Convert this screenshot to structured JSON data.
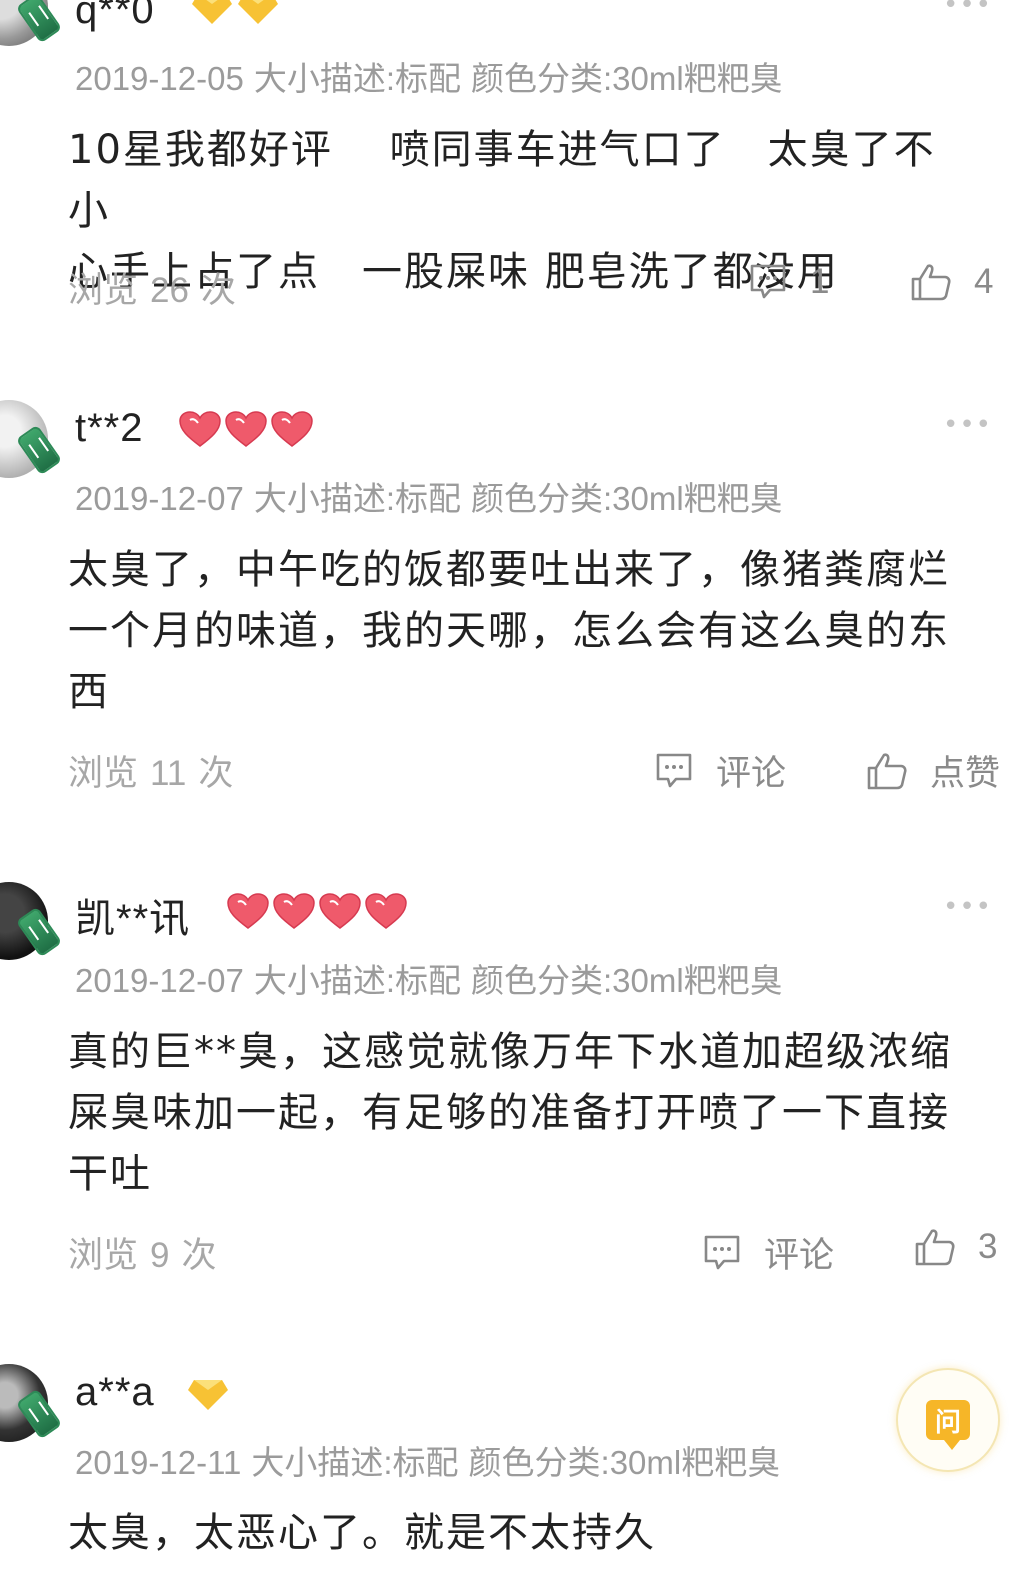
{
  "reviews": [
    {
      "username": "q**0",
      "badge_type": "diamond",
      "badge_count": 2,
      "date": "2019-12-05",
      "size_desc": "大小描述:标配",
      "color_cat": "颜色分类:30ml粑粑臭",
      "lines": [
        "10星我都好评　 喷同事车进气口了　太臭了不小",
        "心手上占了点　一股屎味  肥皂洗了都没用"
      ],
      "views_prefix": "浏览",
      "views_count": "26",
      "views_suffix": "次",
      "comment_label": "1",
      "like_label": "4"
    },
    {
      "username": "t**2",
      "badge_type": "heart",
      "badge_count": 3,
      "date": "2019-12-07",
      "size_desc": "大小描述:标配",
      "color_cat": "颜色分类:30ml粑粑臭",
      "lines": [
        "太臭了，中午吃的饭都要吐出来了，像猪粪腐烂",
        "一个月的味道，我的天哪，怎么会有这么臭的东",
        "西"
      ],
      "views_prefix": "浏览",
      "views_count": "11",
      "views_suffix": "次",
      "comment_label": "评论",
      "like_label": "点赞"
    },
    {
      "username": "凯**讯",
      "badge_type": "heart",
      "badge_count": 4,
      "date": "2019-12-07",
      "size_desc": "大小描述:标配",
      "color_cat": "颜色分类:30ml粑粑臭",
      "lines": [
        "真的巨**臭，这感觉就像万年下水道加超级浓缩",
        "屎臭味加一起，有足够的准备打开喷了一下直接",
        "干吐"
      ],
      "views_prefix": "浏览",
      "views_count": "9",
      "views_suffix": "次",
      "comment_label": "评论",
      "like_label": "3"
    },
    {
      "username": "a**a",
      "badge_type": "diamond",
      "badge_count": 1,
      "date": "2019-12-11",
      "size_desc": "大小描述:标配",
      "color_cat": "颜色分类:30ml粑粑臭",
      "lines": [
        "太臭，太恶心了。就是不太持久"
      ]
    }
  ],
  "more_glyph": "•••",
  "ask_button_label": "问",
  "colors": {
    "heart": "#ef5a6b",
    "diamond": "#f7c234",
    "meta_text": "#9b9b9b",
    "ask_accent": "#f6b628"
  }
}
